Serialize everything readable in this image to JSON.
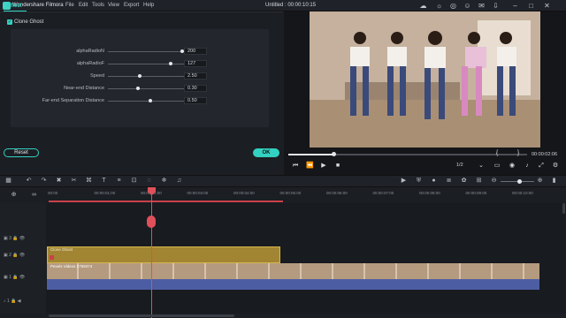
{
  "app": {
    "name": "Wondershare Filmora",
    "menu": [
      "File",
      "Edit",
      "Tools",
      "View",
      "Export",
      "Help"
    ],
    "window_title": "Untitled : 00:00:10:15"
  },
  "effect_panel": {
    "tab": "Effect",
    "section": "Clone Ghost",
    "params": [
      {
        "label": "alphaRadioN",
        "value": "200",
        "level": 0.88
      },
      {
        "label": "alphaRadioF",
        "value": "127",
        "level": 0.74
      },
      {
        "label": "Speed",
        "value": "2.50",
        "level": 0.38
      },
      {
        "label": "Near-end Distance",
        "value": "0.30",
        "level": 0.35
      },
      {
        "label": "Far-end Separation Distance",
        "value": "0.50",
        "level": 0.5
      }
    ],
    "reset_label": "Reset",
    "ok_label": "OK"
  },
  "preview": {
    "progress": 0.19,
    "timecode": "00:00:02:06",
    "ratio": "1/2"
  },
  "timeline": {
    "ticks": [
      "00:00",
      "00:00:01:00",
      "00:00:02:00",
      "00:00:03:00",
      "00:00:04:00",
      "00:00:05:00",
      "00:00:06:00",
      "00:00:07:00",
      "00:00:08:00",
      "00:00:09:00",
      "00:00:10:00"
    ],
    "tracks": [
      {
        "label": "3"
      },
      {
        "label": "2"
      },
      {
        "label": "1"
      },
      {
        "label": "1"
      }
    ],
    "effect_clip": "Clone Ghost",
    "video_clip": "Pexels Videos 2759474"
  }
}
